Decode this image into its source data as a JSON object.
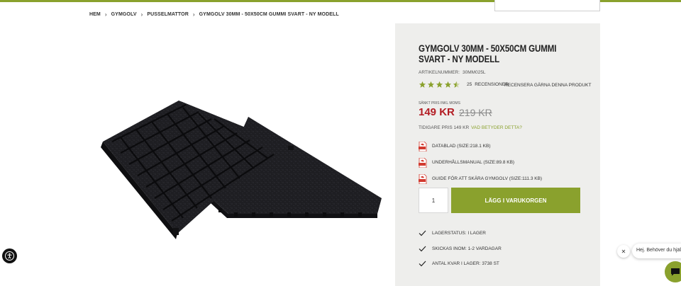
{
  "breadcrumb": {
    "items": [
      "HEM",
      "GYMGOLV",
      "PUSSELMATTOR",
      "GYMGOLV 30MM - 50X50CM GUMMI SVART - NY MODELL"
    ]
  },
  "product": {
    "title": "GYMGOLV 30MM - 50X50CM GUMMI SVART - NY MODELL",
    "article_label": "ARTIKELNUMMER:",
    "article_number": "30MM025L",
    "rating_stars": 4.5,
    "review_count": "25",
    "review_label": "RECENSIONER",
    "write_review": "RECENSERA GÄRNA DENNA PRODUKT",
    "price_caption": "SÄNKT PRIS INKL MOMS",
    "price": "149 KR",
    "old_price": "219 KR",
    "previous_price_text": "TIDIGARE PRIS 149 KR",
    "previous_price_link": "VAD BETYDER DETTA?",
    "documents": [
      {
        "label": "DATABLAD (SIZE:218.1 KB)"
      },
      {
        "label": "UNDERHÅLLSMANUAL (SIZE:89.8 KB)"
      },
      {
        "label": "GUIDE FÖR ATT SKÄRA GYMGOLV (SIZE:111.3 KB)"
      }
    ],
    "quantity": "1",
    "add_to_cart": "LÄGG I VARUKORGEN",
    "status": [
      {
        "label": "LAGERSTATUS: I LAGER"
      },
      {
        "label": "SKICKAS INOM: 1-2 VARDAGAR"
      },
      {
        "label": "ANTAL KVAR I LAGER: 3738 ST"
      }
    ]
  },
  "chat": {
    "greeting": "Hej. Behöver du hjälp?"
  },
  "colors": {
    "accent": "#8aa12d",
    "price": "#b31c23",
    "panel": "#eeeeec"
  },
  "icons": [
    "chevron-right-icon",
    "star-icon",
    "half-star-icon",
    "pdf-icon",
    "check-icon",
    "accessibility-icon",
    "close-icon",
    "chat-icon"
  ]
}
